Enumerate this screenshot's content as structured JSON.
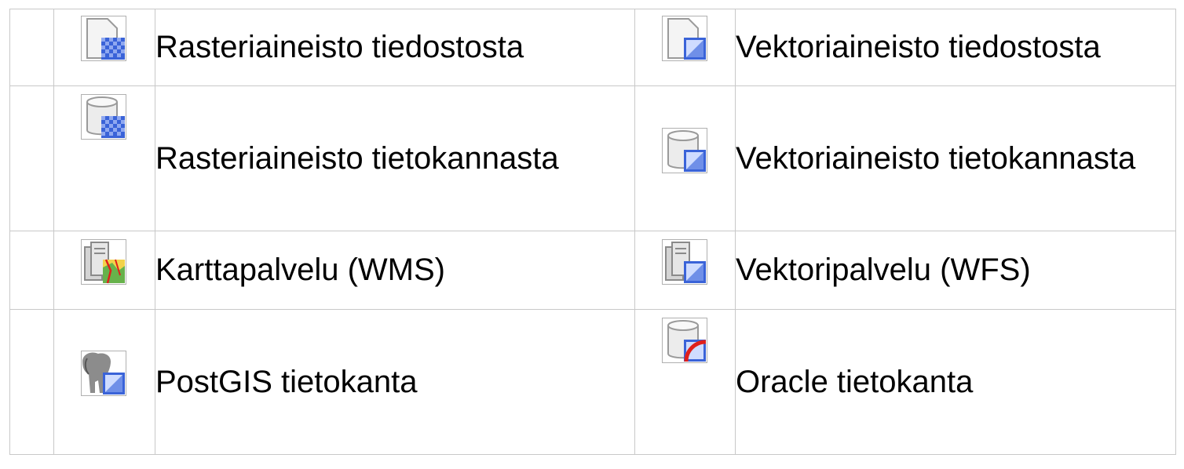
{
  "rows": [
    {
      "left": {
        "icon": "raster-file-icon",
        "label": "Rasteriaineisto tiedostosta"
      },
      "right": {
        "icon": "vector-file-icon",
        "label": "Vektoriaineisto tiedostosta"
      }
    },
    {
      "left": {
        "icon": "raster-database-icon",
        "label": "Rasteriaineisto tietokannasta"
      },
      "right": {
        "icon": "vector-database-icon",
        "label": "Vektoriaineisto tietokannasta"
      }
    },
    {
      "left": {
        "icon": "wms-server-icon",
        "label": "Karttapalvelu (WMS)"
      },
      "right": {
        "icon": "wfs-server-icon",
        "label": "Vektoripalvelu (WFS)"
      }
    },
    {
      "left": {
        "icon": "postgis-elephant-icon",
        "label": "PostGIS tietokanta"
      },
      "right": {
        "icon": "oracle-database-icon",
        "label": "Oracle tietokanta"
      }
    }
  ],
  "colors": {
    "grid_border": "#c8c8c8",
    "blue": "#3a63d8",
    "oracle_red": "#e0201b"
  }
}
